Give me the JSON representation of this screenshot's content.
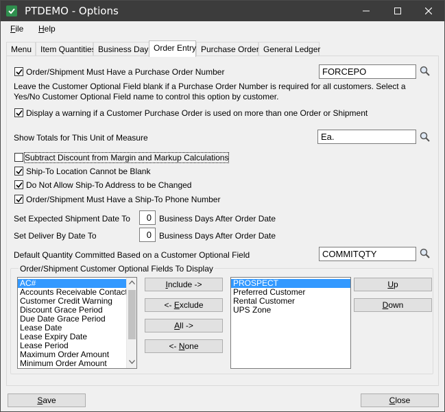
{
  "window": {
    "title": "PTDEMO - Options",
    "app_icon": "checkmark-app-icon",
    "controls": [
      "minimize-icon",
      "maximize-icon",
      "close-icon"
    ]
  },
  "menu": {
    "file": {
      "accel": "F",
      "rest": "ile"
    },
    "help": {
      "accel": "H",
      "rest": "elp"
    }
  },
  "tabs": [
    "Menu",
    "Item Quantities",
    "Business Days",
    "Order Entry",
    "Purchase Orders",
    "General Ledger"
  ],
  "active_tab": "Order Entry",
  "order_entry": {
    "po_required": {
      "checked": true,
      "label": "Order/Shipment Must Have a Purchase Order Number",
      "field_value": "FORCEPO"
    },
    "po_description": "Leave the Customer Optional Field blank if a Purchase Order Number is required for all customers. Select a Yes/No Customer Optional Field name to control this option by customer.",
    "warn_po_reuse": {
      "checked": true,
      "label": "Display a warning if a Customer Purchase Order is used on more than one Order or Shipment"
    },
    "totals_uom": {
      "label": "Show Totals for This Unit of Measure",
      "value": "Ea."
    },
    "subtract_discount": {
      "checked": false,
      "label": "Subtract Discount from Margin and Markup Calculations"
    },
    "shipto_not_blank": {
      "checked": true,
      "label": "Ship-To Location Cannot be Blank"
    },
    "no_shipto_change": {
      "checked": true,
      "label": "Do Not Allow Ship-To Address to be Changed"
    },
    "shipto_phone": {
      "checked": true,
      "label": "Order/Shipment Must Have a Ship-To Phone Number"
    },
    "expected_ship": {
      "label": "Set Expected Shipment Date To",
      "value": "0",
      "suffix": "Business Days After Order Date"
    },
    "deliver_by": {
      "label": "Set Deliver By Date To",
      "value": "0",
      "suffix": "Business Days After Order Date"
    },
    "default_qty": {
      "label": "Default Quantity Committed Based on a Customer Optional Field",
      "value": "COMMITQTY"
    },
    "optional_fields": {
      "group_title": "Order/Shipment Customer Optional Fields To Display",
      "available": [
        "AC#",
        "Accounts Receivable Contact Ty",
        "Customer Credit Warning",
        "Discount Grace Period",
        "Due Date Grace Period",
        "Lease Date",
        "Lease Expiry Date",
        "Lease Period",
        "Maximum Order Amount",
        "Minimum Order Amount"
      ],
      "available_selected": "AC#",
      "selected": [
        "PROSPECT",
        "Preferred Customer",
        "Rental Customer",
        "UPS Zone"
      ],
      "selected_selected": "PROSPECT",
      "buttons": {
        "include": {
          "accel": "I",
          "rest": "nclude ->"
        },
        "exclude": {
          "pre": "<- ",
          "accel": "E",
          "rest": "xclude"
        },
        "all": {
          "accel": "A",
          "rest": "ll ->"
        },
        "none": {
          "pre": "<- ",
          "accel": "N",
          "rest": "one"
        },
        "up": {
          "accel": "U",
          "rest": "p"
        },
        "down": {
          "accel": "D",
          "rest": "own"
        }
      }
    }
  },
  "footer": {
    "save": {
      "accel": "S",
      "rest": "ave"
    },
    "close": {
      "accel": "C",
      "rest": "lose"
    }
  },
  "colors": {
    "titlebar": "#3c3c3c",
    "selection": "#3399ff",
    "app_icon": "#2f8f4e"
  }
}
